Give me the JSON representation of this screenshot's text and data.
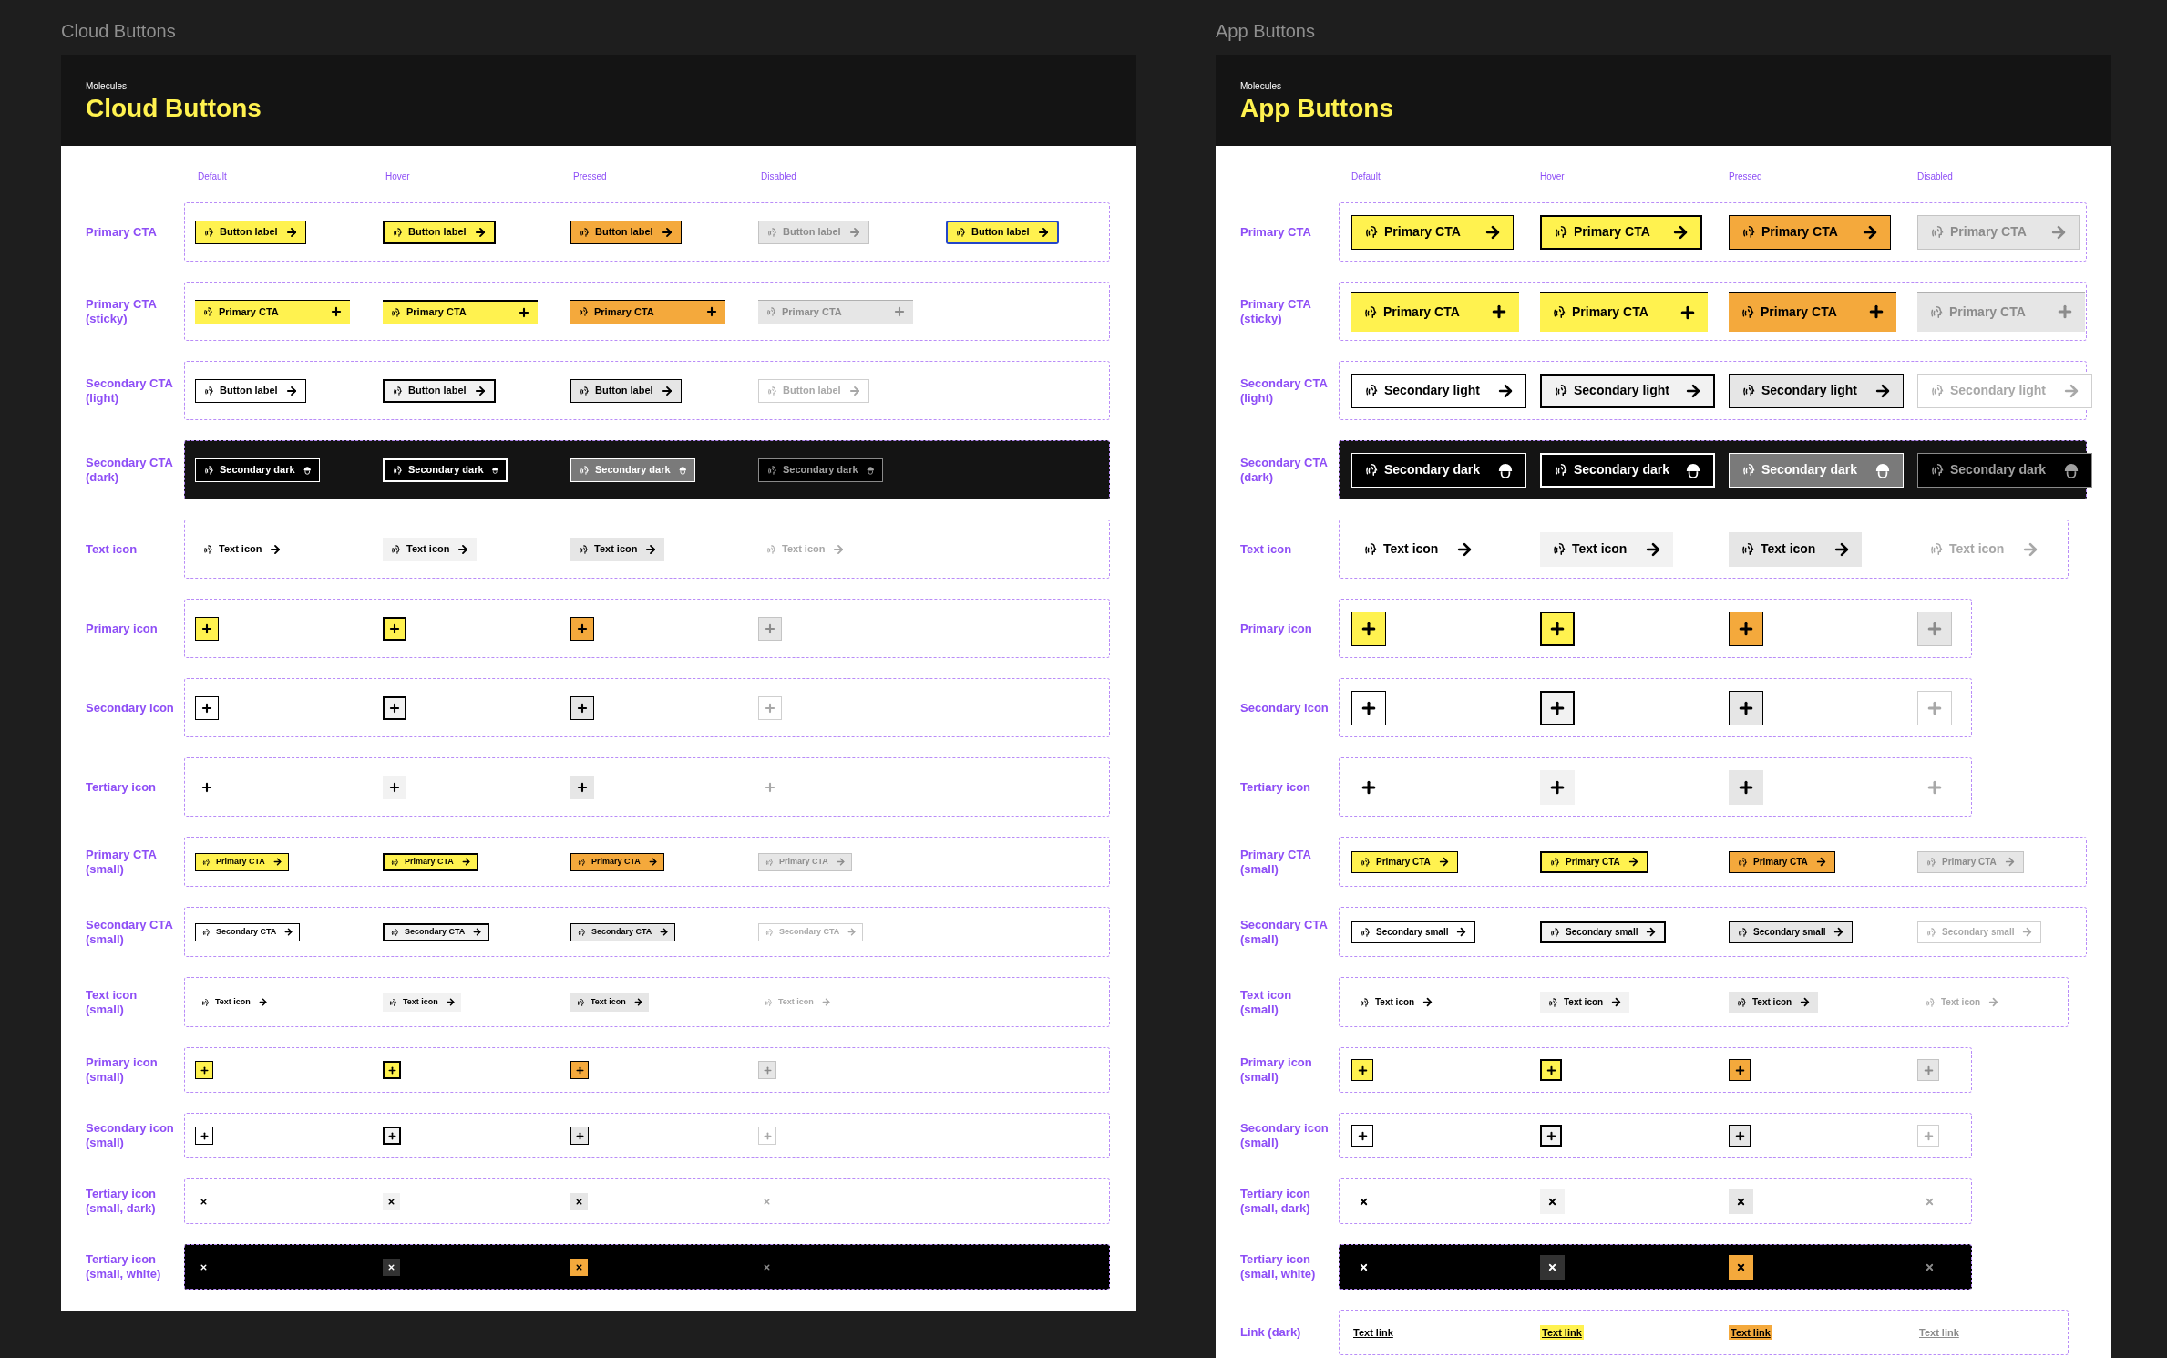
{
  "panels": [
    {
      "kind": "cloud",
      "caption": "Cloud Buttons",
      "eyebrow": "Molecules",
      "title": "Cloud Buttons",
      "states": [
        "Default",
        "Hover",
        "Pressed",
        "Disabled"
      ],
      "rows": [
        {
          "label": [
            "Primary CTA"
          ],
          "kind": "primary",
          "small": false,
          "items": [
            {
              "kind": "default",
              "label": "Button label"
            },
            {
              "kind": "hover",
              "label": "Button label"
            },
            {
              "kind": "pressed",
              "label": "Button label"
            },
            {
              "kind": "disabled",
              "label": "Button label"
            },
            {
              "kind": "focus",
              "label": "Button label"
            }
          ]
        },
        {
          "label": [
            "Primary CTA",
            "(sticky)"
          ],
          "kind": "sticky",
          "small": false,
          "items": [
            {
              "kind": "default",
              "label": "Primary CTA"
            },
            {
              "kind": "hover",
              "label": "Primary CTA"
            },
            {
              "kind": "pressed",
              "label": "Primary CTA"
            },
            {
              "kind": "disabled",
              "label": "Primary CTA"
            }
          ]
        },
        {
          "label": [
            "Secondary CTA",
            "(light)"
          ],
          "kind": "light",
          "small": false,
          "items": [
            {
              "kind": "default",
              "label": "Button label"
            },
            {
              "kind": "hover",
              "label": "Button label"
            },
            {
              "kind": "pressed",
              "label": "Button label"
            },
            {
              "kind": "disabled",
              "label": "Button label"
            }
          ]
        },
        {
          "label": [
            "Secondary CTA",
            "(dark)"
          ],
          "kind": "dark",
          "small": false,
          "items": [
            {
              "kind": "default",
              "label": "Secondary dark"
            },
            {
              "kind": "hover",
              "label": "Secondary dark"
            },
            {
              "kind": "pressed",
              "label": "Secondary dark"
            },
            {
              "kind": "disabled",
              "label": "Secondary dark"
            }
          ]
        },
        {
          "label": [
            "Text icon"
          ],
          "kind": "text",
          "small": false,
          "items": [
            {
              "kind": "default",
              "label": "Text icon"
            },
            {
              "kind": "hover",
              "label": "Text icon"
            },
            {
              "kind": "pressed",
              "label": "Text icon"
            },
            {
              "kind": "disabled",
              "label": "Text icon"
            }
          ]
        },
        {
          "label": [
            "Primary icon"
          ],
          "kind": "filled",
          "small": false,
          "items": [
            {
              "kind": "default"
            },
            {
              "kind": "hover"
            },
            {
              "kind": "pressed"
            },
            {
              "kind": "disabled"
            }
          ]
        },
        {
          "label": [
            "Secondary icon"
          ],
          "kind": "outlined",
          "small": false,
          "items": [
            {
              "kind": "default"
            },
            {
              "kind": "hover"
            },
            {
              "kind": "pressed"
            },
            {
              "kind": "disabled"
            }
          ]
        },
        {
          "label": [
            "Tertiary icon"
          ],
          "kind": "plain",
          "small": false,
          "items": [
            {
              "kind": "default"
            },
            {
              "kind": "hover"
            },
            {
              "kind": "pressed"
            },
            {
              "kind": "disabled"
            }
          ]
        },
        {
          "label": [
            "Primary CTA",
            "(small)"
          ],
          "kind": "primary",
          "small": true,
          "items": [
            {
              "kind": "default",
              "label": "Primary CTA"
            },
            {
              "kind": "hover",
              "label": "Primary CTA"
            },
            {
              "kind": "pressed",
              "label": "Primary CTA"
            },
            {
              "kind": "disabled",
              "label": "Primary CTA"
            }
          ]
        },
        {
          "label": [
            "Secondary CTA",
            "(small)"
          ],
          "kind": "light",
          "small": true,
          "items": [
            {
              "kind": "default",
              "label": "Secondary CTA"
            },
            {
              "kind": "hover",
              "label": "Secondary CTA"
            },
            {
              "kind": "pressed",
              "label": "Secondary CTA"
            },
            {
              "kind": "disabled",
              "label": "Secondary CTA"
            }
          ]
        },
        {
          "label": [
            "Text icon",
            "(small)"
          ],
          "kind": "text",
          "small": true,
          "items": [
            {
              "kind": "default",
              "label": "Text icon"
            },
            {
              "kind": "hover",
              "label": "Text icon"
            },
            {
              "kind": "pressed",
              "label": "Text icon"
            },
            {
              "kind": "disabled",
              "label": "Text icon"
            }
          ]
        },
        {
          "label": [
            "Primary icon",
            "(small)"
          ],
          "kind": "filled",
          "small": true,
          "items": [
            {
              "kind": "default"
            },
            {
              "kind": "hover"
            },
            {
              "kind": "pressed"
            },
            {
              "kind": "disabled"
            }
          ]
        },
        {
          "label": [
            "Secondary icon",
            "(small)"
          ],
          "kind": "outlined",
          "small": true,
          "items": [
            {
              "kind": "default"
            },
            {
              "kind": "hover"
            },
            {
              "kind": "pressed"
            },
            {
              "kind": "disabled"
            }
          ]
        },
        {
          "label": [
            "Tertiary icon",
            "(small, dark)"
          ],
          "kind": "cross",
          "small": true,
          "items": [
            {
              "kind": "default"
            },
            {
              "kind": "hover"
            },
            {
              "kind": "pressed"
            },
            {
              "kind": "disabled"
            }
          ]
        },
        {
          "label": [
            "Tertiary icon",
            "(small, white)"
          ],
          "kind": "crosswhite",
          "small": true,
          "items": [
            {
              "kind": "default"
            },
            {
              "kind": "hover"
            },
            {
              "kind": "pressed"
            },
            {
              "kind": "disabled"
            }
          ]
        }
      ]
    },
    {
      "kind": "app",
      "caption": "App Buttons",
      "eyebrow": "Molecules",
      "title": "App Buttons",
      "states": [
        "Default",
        "Hover",
        "Pressed",
        "Disabled"
      ],
      "rows": [
        {
          "label": [
            "Primary CTA"
          ],
          "kind": "primary",
          "small": false,
          "items": [
            {
              "kind": "default",
              "label": "Primary CTA"
            },
            {
              "kind": "hover",
              "label": "Primary CTA"
            },
            {
              "kind": "pressed",
              "label": "Primary CTA"
            },
            {
              "kind": "disabled",
              "label": "Primary CTA"
            }
          ]
        },
        {
          "label": [
            "Primary CTA",
            "(sticky)"
          ],
          "kind": "sticky",
          "small": false,
          "items": [
            {
              "kind": "default",
              "label": "Primary CTA"
            },
            {
              "kind": "hover",
              "label": "Primary CTA"
            },
            {
              "kind": "pressed",
              "label": "Primary CTA"
            },
            {
              "kind": "disabled",
              "label": "Primary CTA"
            }
          ]
        },
        {
          "label": [
            "Secondary CTA",
            "(light)"
          ],
          "kind": "light",
          "small": false,
          "items": [
            {
              "kind": "default",
              "label": "Secondary light"
            },
            {
              "kind": "hover",
              "label": "Secondary light"
            },
            {
              "kind": "pressed",
              "label": "Secondary light"
            },
            {
              "kind": "disabled",
              "label": "Secondary light"
            }
          ]
        },
        {
          "label": [
            "Secondary CTA",
            "(dark)"
          ],
          "kind": "dark",
          "small": false,
          "items": [
            {
              "kind": "default",
              "label": "Secondary dark"
            },
            {
              "kind": "hover",
              "label": "Secondary dark"
            },
            {
              "kind": "pressed",
              "label": "Secondary dark"
            },
            {
              "kind": "disabled",
              "label": "Secondary dark"
            }
          ]
        },
        {
          "label": [
            "Text icon"
          ],
          "kind": "text",
          "small": false,
          "items": [
            {
              "kind": "default",
              "label": "Text icon"
            },
            {
              "kind": "hover",
              "label": "Text icon"
            },
            {
              "kind": "pressed",
              "label": "Text icon"
            },
            {
              "kind": "disabled",
              "label": "Text icon"
            }
          ]
        },
        {
          "label": [
            "Primary icon"
          ],
          "kind": "filled",
          "small": false,
          "items": [
            {
              "kind": "default"
            },
            {
              "kind": "hover"
            },
            {
              "kind": "pressed"
            },
            {
              "kind": "disabled"
            }
          ]
        },
        {
          "label": [
            "Secondary icon"
          ],
          "kind": "outlined",
          "small": false,
          "items": [
            {
              "kind": "default"
            },
            {
              "kind": "hover"
            },
            {
              "kind": "pressed"
            },
            {
              "kind": "disabled"
            }
          ]
        },
        {
          "label": [
            "Tertiary icon"
          ],
          "kind": "plain",
          "small": false,
          "items": [
            {
              "kind": "default"
            },
            {
              "kind": "hover"
            },
            {
              "kind": "pressed"
            },
            {
              "kind": "disabled"
            }
          ]
        },
        {
          "label": [
            "Primary CTA",
            "(small)"
          ],
          "kind": "primary",
          "small": true,
          "items": [
            {
              "kind": "default",
              "label": "Primary CTA"
            },
            {
              "kind": "hover",
              "label": "Primary CTA"
            },
            {
              "kind": "pressed",
              "label": "Primary CTA"
            },
            {
              "kind": "disabled",
              "label": "Primary CTA"
            }
          ]
        },
        {
          "label": [
            "Secondary CTA",
            "(small)"
          ],
          "kind": "light",
          "small": true,
          "items": [
            {
              "kind": "default",
              "label": "Secondary small"
            },
            {
              "kind": "hover",
              "label": "Secondary small"
            },
            {
              "kind": "pressed",
              "label": "Secondary small"
            },
            {
              "kind": "disabled",
              "label": "Secondary small"
            }
          ]
        },
        {
          "label": [
            "Text icon",
            "(small)"
          ],
          "kind": "text",
          "small": true,
          "items": [
            {
              "kind": "default",
              "label": "Text icon"
            },
            {
              "kind": "hover",
              "label": "Text icon"
            },
            {
              "kind": "pressed",
              "label": "Text icon"
            },
            {
              "kind": "disabled",
              "label": "Text icon"
            }
          ]
        },
        {
          "label": [
            "Primary icon",
            "(small)"
          ],
          "kind": "filled",
          "small": true,
          "items": [
            {
              "kind": "default"
            },
            {
              "kind": "hover"
            },
            {
              "kind": "pressed"
            },
            {
              "kind": "disabled"
            }
          ]
        },
        {
          "label": [
            "Secondary icon",
            "(small)"
          ],
          "kind": "outlined",
          "small": true,
          "items": [
            {
              "kind": "default"
            },
            {
              "kind": "hover"
            },
            {
              "kind": "pressed"
            },
            {
              "kind": "disabled"
            }
          ]
        },
        {
          "label": [
            "Tertiary icon",
            "(small, dark)"
          ],
          "kind": "cross",
          "small": true,
          "items": [
            {
              "kind": "default"
            },
            {
              "kind": "hover"
            },
            {
              "kind": "pressed"
            },
            {
              "kind": "disabled"
            }
          ]
        },
        {
          "label": [
            "Tertiary icon",
            "(small, white)"
          ],
          "kind": "crosswhite",
          "small": true,
          "items": [
            {
              "kind": "default"
            },
            {
              "kind": "hover"
            },
            {
              "kind": "pressed"
            },
            {
              "kind": "disabled"
            }
          ]
        },
        {
          "label": [
            "Link (dark)"
          ],
          "kind": "link",
          "small": true,
          "items": [
            {
              "kind": "default",
              "label": "Text link"
            },
            {
              "kind": "hover",
              "label": "Text link"
            },
            {
              "kind": "pressed",
              "label": "Text link"
            },
            {
              "kind": "disabled",
              "label": "Text link"
            }
          ]
        }
      ]
    }
  ]
}
